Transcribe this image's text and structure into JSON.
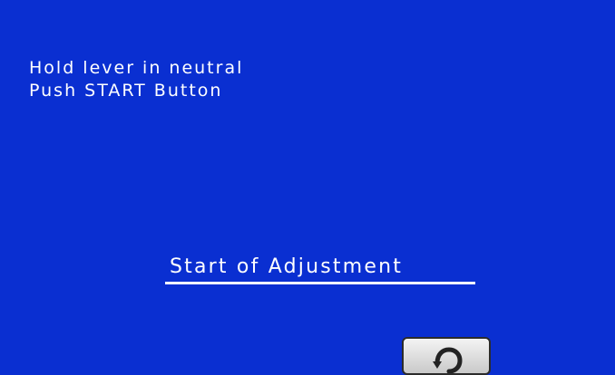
{
  "instructions": {
    "line1": "Hold lever in neutral",
    "line2": "Push START Button"
  },
  "status": {
    "label": "Start of Adjustment"
  },
  "back_button": {
    "icon": "return-arrow-icon"
  },
  "colors": {
    "background": "#0a2fd1",
    "text": "#ffffff",
    "button_face": "#e0e0e0",
    "button_border": "#2b2b2b"
  }
}
